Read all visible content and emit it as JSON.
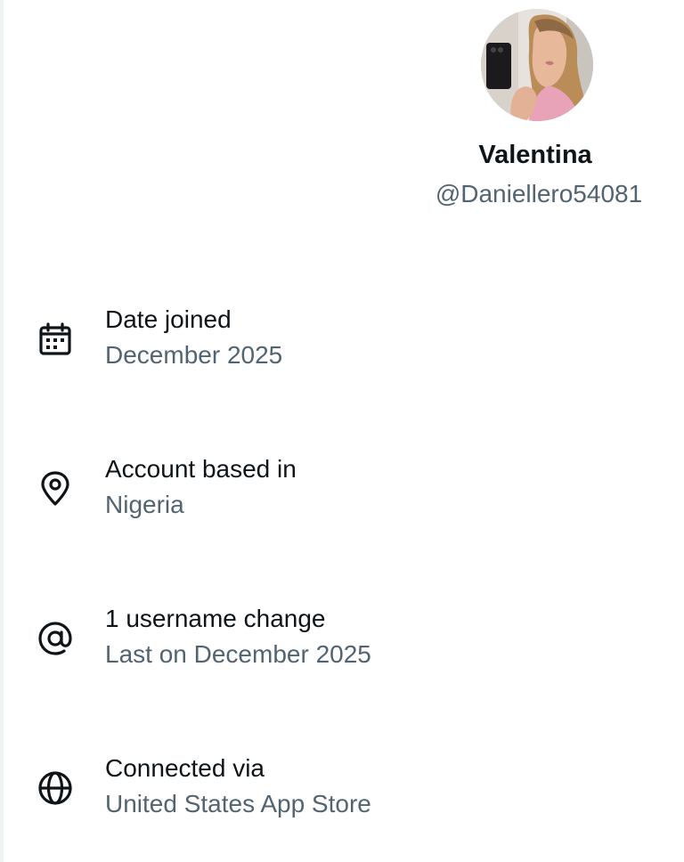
{
  "profile": {
    "display_name": "Valentina",
    "handle": "@Daniellero54081"
  },
  "about": {
    "rows": [
      {
        "icon": "calendar-icon",
        "label": "Date joined",
        "value": "December 2025"
      },
      {
        "icon": "location-pin-icon",
        "label": "Account based in",
        "value": "Nigeria"
      },
      {
        "icon": "at-sign-icon",
        "label": "1 username change",
        "value": "Last on December 2025"
      },
      {
        "icon": "globe-icon",
        "label": "Connected via",
        "value": "United States App Store"
      }
    ]
  },
  "colors": {
    "primary_text": "#0f1419",
    "secondary_text": "#536471",
    "background": "#ffffff"
  }
}
